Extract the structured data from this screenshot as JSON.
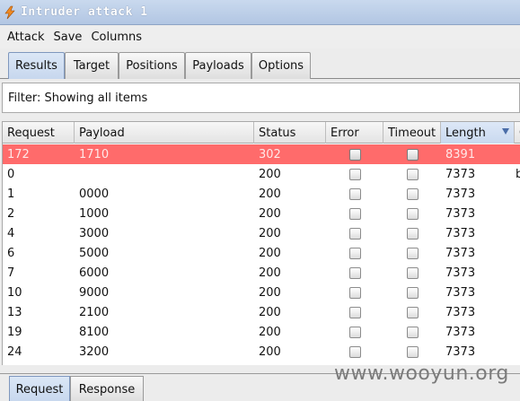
{
  "window": {
    "title": "Intruder attack 1",
    "icon": "burp-lightning-icon"
  },
  "menu": [
    "Attack",
    "Save",
    "Columns"
  ],
  "tabs": [
    "Results",
    "Target",
    "Positions",
    "Payloads",
    "Options"
  ],
  "active_tab": "Results",
  "filter": {
    "text": "Filter: Showing all items"
  },
  "table": {
    "columns": [
      "Request",
      "Payload",
      "Status",
      "Error",
      "Timeout",
      "Length"
    ],
    "sorted_column": "Length",
    "sort_direction": "descending",
    "overflow_header": "C",
    "overflow_cell_row1": "b",
    "rows": [
      {
        "request": "172",
        "payload": "1710",
        "status": "302",
        "error": false,
        "timeout": false,
        "length": "8391",
        "selected": true
      },
      {
        "request": "0",
        "payload": "",
        "status": "200",
        "error": false,
        "timeout": false,
        "length": "7373"
      },
      {
        "request": "1",
        "payload": "0000",
        "status": "200",
        "error": false,
        "timeout": false,
        "length": "7373"
      },
      {
        "request": "2",
        "payload": "1000",
        "status": "200",
        "error": false,
        "timeout": false,
        "length": "7373"
      },
      {
        "request": "4",
        "payload": "3000",
        "status": "200",
        "error": false,
        "timeout": false,
        "length": "7373"
      },
      {
        "request": "6",
        "payload": "5000",
        "status": "200",
        "error": false,
        "timeout": false,
        "length": "7373"
      },
      {
        "request": "7",
        "payload": "6000",
        "status": "200",
        "error": false,
        "timeout": false,
        "length": "7373"
      },
      {
        "request": "10",
        "payload": "9000",
        "status": "200",
        "error": false,
        "timeout": false,
        "length": "7373"
      },
      {
        "request": "13",
        "payload": "2100",
        "status": "200",
        "error": false,
        "timeout": false,
        "length": "7373"
      },
      {
        "request": "19",
        "payload": "8100",
        "status": "200",
        "error": false,
        "timeout": false,
        "length": "7373"
      },
      {
        "request": "24",
        "payload": "3200",
        "status": "200",
        "error": false,
        "timeout": false,
        "length": "7373"
      }
    ]
  },
  "bottom_tabs": [
    "Request",
    "Response"
  ],
  "active_bottom_tab": "Request",
  "watermark": "www.wooyun.org",
  "colors": {
    "selected_row": "#ff6b6b",
    "active_tab": "#c7d7ee",
    "titlebar": "#b2c6e3"
  }
}
